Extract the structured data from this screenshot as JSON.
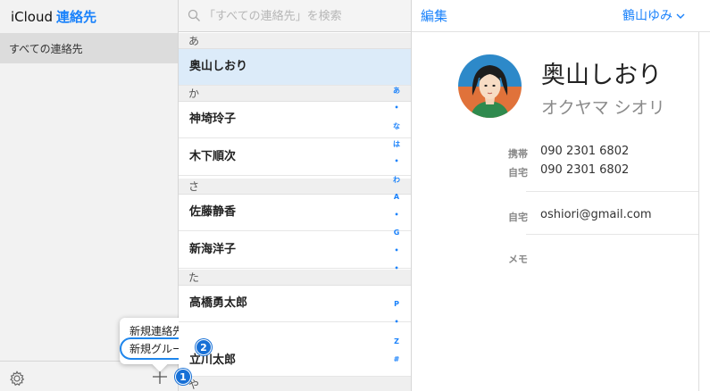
{
  "sidebar": {
    "brand": "iCloud",
    "app_name": "連絡先",
    "group_all": "すべての連絡先",
    "popup": {
      "new_contact": "新規連絡先",
      "new_group": "新規グループ"
    },
    "badges": [
      "1",
      "2"
    ]
  },
  "list": {
    "search_placeholder": "「すべての連絡先」を検索",
    "sections": [
      {
        "header": "あ",
        "contacts": [
          "奥山しおり"
        ]
      },
      {
        "header": "か",
        "contacts": [
          "神埼玲子",
          "木下順次"
        ]
      },
      {
        "header": "さ",
        "contacts": [
          "佐藤静香",
          "新海洋子"
        ]
      },
      {
        "header": "た",
        "contacts": [
          "高橋勇太郎",
          "立川太郎"
        ]
      },
      {
        "header": "や",
        "contacts": []
      }
    ],
    "alpha_index": [
      "あ",
      "•",
      "な",
      "は",
      "•",
      "わ",
      "A",
      "•",
      "G",
      "•",
      "•",
      "P",
      "•",
      "Z",
      "#"
    ]
  },
  "detail": {
    "edit_label": "編集",
    "user_name": "鶴山ゆみ",
    "contact_name": "奥山しおり",
    "contact_kana": "オクヤマ シオリ",
    "fields": [
      {
        "label": "携帯",
        "value": "090 2301 6802"
      },
      {
        "label": "自宅",
        "value": "090 2301 6802"
      },
      {
        "label": "自宅",
        "value": "oshiori@gmail.com"
      },
      {
        "label": "メモ",
        "value": ""
      }
    ]
  },
  "colors": {
    "accent": "#1a82fb",
    "selected_row": "#dcebf9",
    "badge": "#1770d6"
  }
}
